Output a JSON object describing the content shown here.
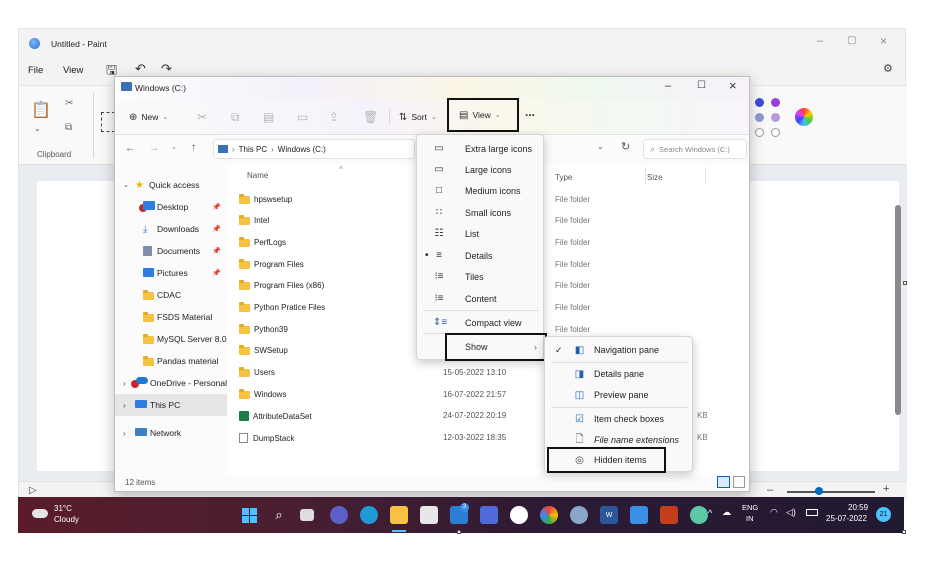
{
  "paint": {
    "title": "Untitled - Paint",
    "menu_file": "File",
    "menu_view": "View",
    "clipboard_label": "Clipboard"
  },
  "explorer": {
    "title": "Windows (C:)",
    "toolbar": {
      "new_label": "New",
      "sort_label": "Sort",
      "view_label": "View",
      "more_label": "..."
    },
    "address": {
      "this_pc": "This PC",
      "drive": "Windows (C:)",
      "search_placeholder": "Search Windows (C:)"
    },
    "columns": {
      "name": "Name",
      "type": "Type",
      "size": "Size"
    },
    "nav": [
      {
        "label": "Quick access"
      },
      {
        "label": "Desktop"
      },
      {
        "label": "Downloads"
      },
      {
        "label": "Documents"
      },
      {
        "label": "Pictures"
      },
      {
        "label": "CDAC"
      },
      {
        "label": "FSDS Material"
      },
      {
        "label": "MySQL Server 8.0"
      },
      {
        "label": "Pandas material"
      },
      {
        "label": "OneDrive - Personal"
      },
      {
        "label": "This PC"
      },
      {
        "label": "Network"
      }
    ],
    "files": [
      {
        "name": "hpswsetup",
        "date": "",
        "type": "File folder",
        "size": ""
      },
      {
        "name": "Intel",
        "date": "",
        "type": "File folder",
        "size": ""
      },
      {
        "name": "PerfLogs",
        "date": "",
        "type": "File folder",
        "size": ""
      },
      {
        "name": "Program Files",
        "date": "",
        "type": "File folder",
        "size": ""
      },
      {
        "name": "Program Files (x86)",
        "date": "",
        "type": "File folder",
        "size": ""
      },
      {
        "name": "Python Pratice Files",
        "date": "",
        "type": "File folder",
        "size": ""
      },
      {
        "name": "Python39",
        "date": "",
        "type": "File folder",
        "size": ""
      },
      {
        "name": "SWSetup",
        "date": "",
        "type": "",
        "size": ""
      },
      {
        "name": "Users",
        "date": "15-05-2022 13:10",
        "type": "",
        "size": ""
      },
      {
        "name": "Windows",
        "date": "16-07-2022 21:57",
        "type": "",
        "size": ""
      },
      {
        "name": "AttributeDataSet",
        "date": "24-07-2022 20:19",
        "type": "",
        "size": "KB"
      },
      {
        "name": "DumpStack",
        "date": "12-03-2022 18:35",
        "type": "",
        "size": "KB"
      }
    ],
    "status_items": "12 items"
  },
  "view_menu": {
    "items": [
      {
        "label": "Extra large icons",
        "icon": "monitor-icon"
      },
      {
        "label": "Large icons",
        "icon": "monitor-icon"
      },
      {
        "label": "Medium icons",
        "icon": "monitor-small-icon"
      },
      {
        "label": "Small icons",
        "icon": "grid-small-icon"
      },
      {
        "label": "List",
        "icon": "list-icon"
      },
      {
        "label": "Details",
        "icon": "details-icon"
      },
      {
        "label": "Tiles",
        "icon": "tiles-icon"
      },
      {
        "label": "Content",
        "icon": "content-icon"
      },
      {
        "label": "Compact view",
        "icon": "compact-icon"
      },
      {
        "label": "Show",
        "icon": ""
      }
    ]
  },
  "show_menu": {
    "items": [
      {
        "label": "Navigation pane",
        "checked": true
      },
      {
        "label": "Details pane",
        "checked": false
      },
      {
        "label": "Preview pane",
        "checked": false
      },
      {
        "label": "Item check boxes",
        "checked": false
      },
      {
        "label": "File name extensions",
        "checked": false
      },
      {
        "label": "Hidden items",
        "checked": false
      }
    ]
  },
  "taskbar": {
    "weather_temp": "31°C",
    "weather_desc": "Cloudy",
    "lang_top": "ENG",
    "lang_bottom": "IN",
    "time": "20:59",
    "date": "25-07-2022",
    "notif_count": "21"
  },
  "colors": {
    "accent": "#0067c0",
    "box_highlight": "#111111",
    "folder": "#f5c242"
  }
}
